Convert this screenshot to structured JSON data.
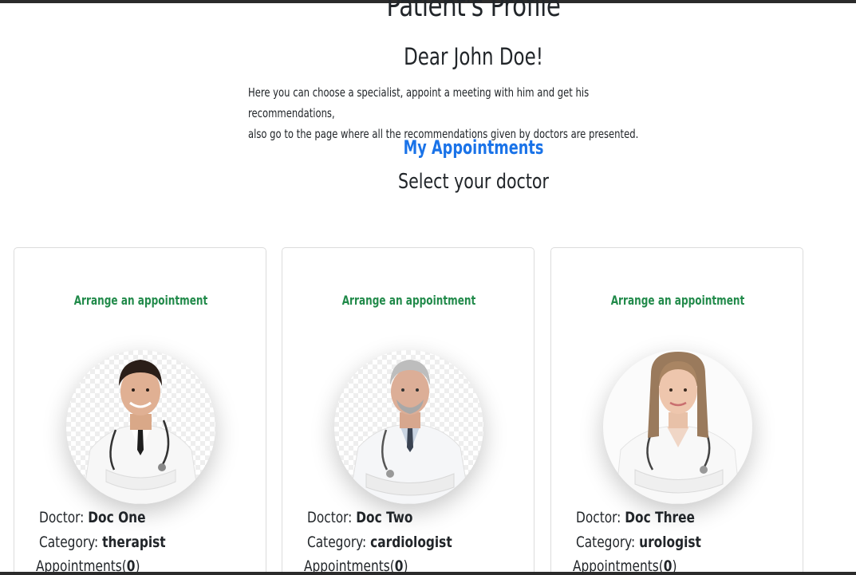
{
  "page": {
    "title": "Patient's Profile",
    "greeting": "Dear John Doe!",
    "intro_line1": "Here you can choose a specialist, appoint a meeting with him and get his recommendations,",
    "intro_line2": "also go to the page where all the recommendations given by doctors are presented.",
    "appointments_link": "My Appointments",
    "select_heading": "Select your doctor"
  },
  "labels": {
    "doctor": "Doctor:",
    "category": "Category:",
    "appointments_prefix": "Appointments(",
    "appointments_suffix": ")"
  },
  "doctors": [
    {
      "arrange_label": "Arrange an appointment",
      "name": "Doc One",
      "category": "therapist",
      "appointments": "0"
    },
    {
      "arrange_label": "Arrange an appointment",
      "name": "Doc Two",
      "category": "cardiologist",
      "appointments": "0"
    },
    {
      "arrange_label": "Arrange an appointment",
      "name": "Doc Three",
      "category": "urologist",
      "appointments": "0"
    }
  ],
  "colors": {
    "link_blue": "#1a73e8",
    "arrange_green": "#218a4a",
    "text": "#212529"
  }
}
